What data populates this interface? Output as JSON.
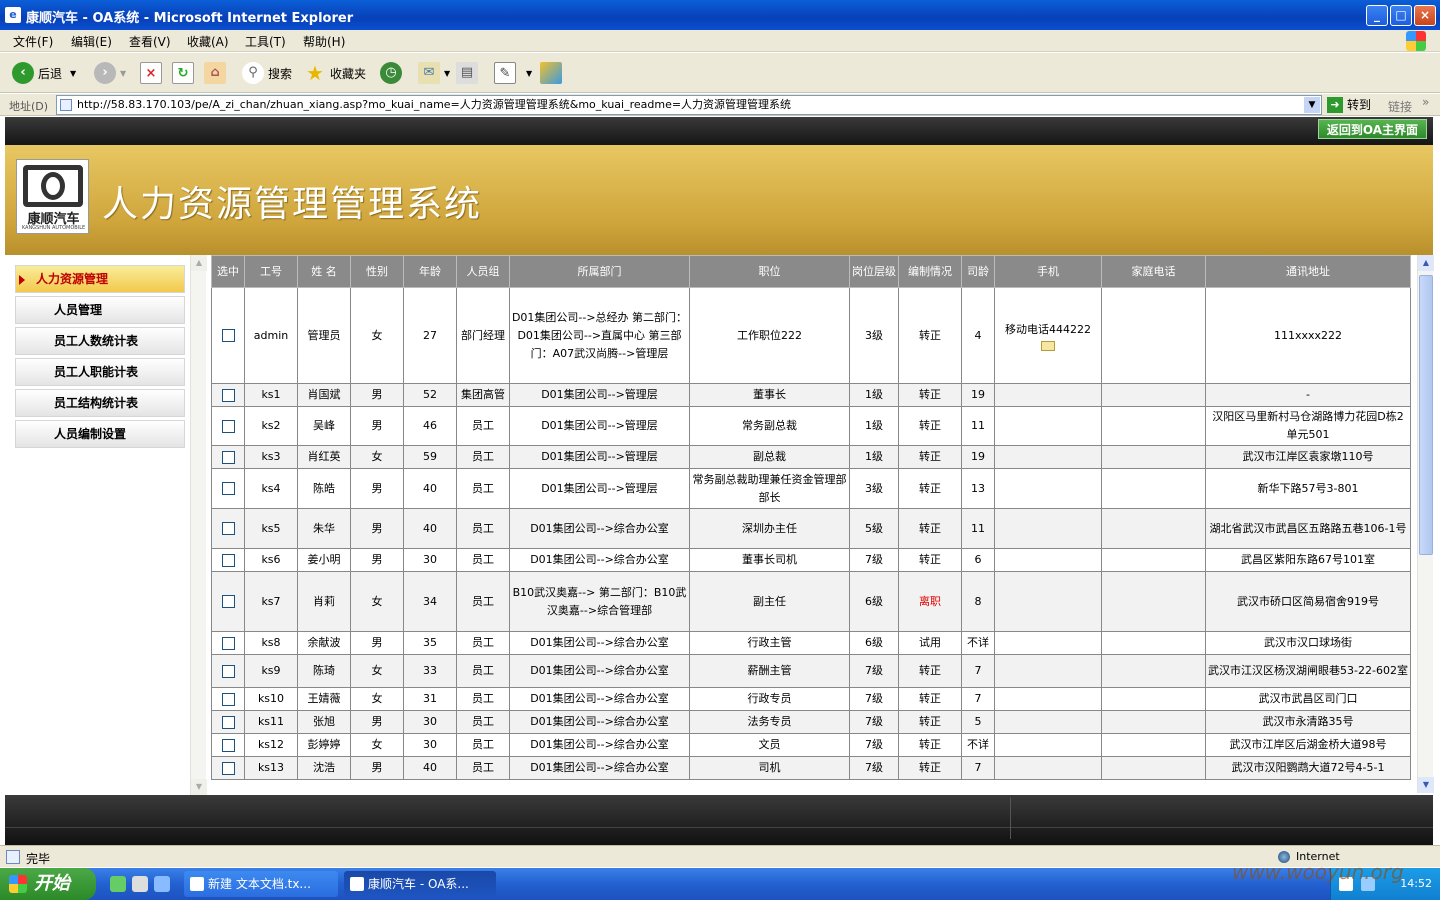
{
  "window": {
    "title": "康顺汽车 - OA系统 - Microsoft Internet Explorer",
    "min_glyph": "_",
    "max_glyph": "□",
    "close_glyph": "×"
  },
  "menu": [
    "文件(F)",
    "编辑(E)",
    "查看(V)",
    "收藏(A)",
    "工具(T)",
    "帮助(H)"
  ],
  "toolbar": {
    "back": "后退",
    "search": "搜索",
    "favorites": "收藏夹"
  },
  "address": {
    "label": "地址(D)",
    "url": "http://58.83.170.103/pe/A_zi_chan/zhuan_xiang.asp?mo_kuai_name=人力资源管理管理系统&mo_kuai_readme=人力资源管理管理系统",
    "go": "转到",
    "links": "链接"
  },
  "header": {
    "return_button": "返回到OA主界面",
    "logo_name": "康顺汽车",
    "logo_sub": "KANGSHUN AUTOMOBILE",
    "system_title": "人力资源管理管理系统"
  },
  "sidebar": {
    "items": [
      {
        "label": "人力资源管理",
        "active": true
      },
      {
        "label": "人员管理",
        "active": false
      },
      {
        "label": "员工人数统计表",
        "active": false
      },
      {
        "label": "员工人职能计表",
        "active": false
      },
      {
        "label": "员工结构统计表",
        "active": false
      },
      {
        "label": "人员编制设置",
        "active": false
      }
    ]
  },
  "table": {
    "columns": [
      "选中",
      "工号",
      "姓 名",
      "性别",
      "年龄",
      "人员组",
      "所属部门",
      "职位",
      "岗位层级",
      "编制情况",
      "司龄",
      "手机",
      "家庭电话",
      "通讯地址"
    ],
    "rows": [
      {
        "id": "admin",
        "name": "管理员",
        "gender": "女",
        "age": "27",
        "group": "部门经理",
        "dept": "D01集团公司-->总经办 第二部门：D01集团公司-->直属中心 第三部门：A07武汉尚腾-->管理层",
        "position": "工作职位222",
        "level": "3级",
        "status": "转正",
        "tenure": "4",
        "mobile": "移动电话444222",
        "home": "",
        "address": "111xxxx222"
      },
      {
        "id": "ks1",
        "name": "肖国斌",
        "gender": "男",
        "age": "52",
        "group": "集团高管",
        "dept": "D01集团公司-->管理层",
        "position": "董事长",
        "level": "1级",
        "status": "转正",
        "tenure": "19",
        "mobile": "",
        "home": "",
        "address": "-"
      },
      {
        "id": "ks2",
        "name": "吴峰",
        "gender": "男",
        "age": "46",
        "group": "员工",
        "dept": "D01集团公司-->管理层",
        "position": "常务副总裁",
        "level": "1级",
        "status": "转正",
        "tenure": "11",
        "mobile": "",
        "home": "",
        "address": "汉阳区马里新村马仓湖路博力花园D栋2单元501"
      },
      {
        "id": "ks3",
        "name": "肖红英",
        "gender": "女",
        "age": "59",
        "group": "员工",
        "dept": "D01集团公司-->管理层",
        "position": "副总裁",
        "level": "1级",
        "status": "转正",
        "tenure": "19",
        "mobile": "",
        "home": "",
        "address": "武汉市江岸区袁家墩110号"
      },
      {
        "id": "ks4",
        "name": "陈皓",
        "gender": "男",
        "age": "40",
        "group": "员工",
        "dept": "D01集团公司-->管理层",
        "position": "常务副总裁助理兼任资金管理部部长",
        "level": "3级",
        "status": "转正",
        "tenure": "13",
        "mobile": "",
        "home": "",
        "address": "新华下路57号3-801"
      },
      {
        "id": "ks5",
        "name": "朱华",
        "gender": "男",
        "age": "40",
        "group": "员工",
        "dept": "D01集团公司-->综合办公室",
        "position": "深圳办主任",
        "level": "5级",
        "status": "转正",
        "tenure": "11",
        "mobile": "",
        "home": "",
        "address": "湖北省武汉市武昌区五路路五巷106-1号"
      },
      {
        "id": "ks6",
        "name": "姜小明",
        "gender": "男",
        "age": "30",
        "group": "员工",
        "dept": "D01集团公司-->综合办公室",
        "position": "董事长司机",
        "level": "7级",
        "status": "转正",
        "tenure": "6",
        "mobile": "",
        "home": "",
        "address": "武昌区紫阳东路67号101室"
      },
      {
        "id": "ks7",
        "name": "肖莉",
        "gender": "女",
        "age": "34",
        "group": "员工",
        "dept": "B10武汉奥嘉--> 第二部门：B10武汉奥嘉-->综合管理部",
        "position": "副主任",
        "level": "6级",
        "status": "离职",
        "tenure": "8",
        "mobile": "",
        "home": "",
        "address": "武汉市硚口区简易宿舍919号"
      },
      {
        "id": "ks8",
        "name": "余献波",
        "gender": "男",
        "age": "35",
        "group": "员工",
        "dept": "D01集团公司-->综合办公室",
        "position": "行政主管",
        "level": "6级",
        "status": "试用",
        "tenure": "不详",
        "mobile": "",
        "home": "",
        "address": "武汉市汉口球场街"
      },
      {
        "id": "ks9",
        "name": "陈琦",
        "gender": "女",
        "age": "33",
        "group": "员工",
        "dept": "D01集团公司-->综合办公室",
        "position": "薪酬主管",
        "level": "7级",
        "status": "转正",
        "tenure": "7",
        "mobile": "",
        "home": "",
        "address": "武汉市江汉区杨汊湖闸眼巷53-22-602室"
      },
      {
        "id": "ks10",
        "name": "王婧薇",
        "gender": "女",
        "age": "31",
        "group": "员工",
        "dept": "D01集团公司-->综合办公室",
        "position": "行政专员",
        "level": "7级",
        "status": "转正",
        "tenure": "7",
        "mobile": "",
        "home": "",
        "address": "武汉市武昌区司门口"
      },
      {
        "id": "ks11",
        "name": "张旭",
        "gender": "男",
        "age": "30",
        "group": "员工",
        "dept": "D01集团公司-->综合办公室",
        "position": "法务专员",
        "level": "7级",
        "status": "转正",
        "tenure": "5",
        "mobile": "",
        "home": "",
        "address": "武汉市永清路35号"
      },
      {
        "id": "ks12",
        "name": "彭婷婷",
        "gender": "女",
        "age": "30",
        "group": "员工",
        "dept": "D01集团公司-->综合办公室",
        "position": "文员",
        "level": "7级",
        "status": "转正",
        "tenure": "不详",
        "mobile": "",
        "home": "",
        "address": "武汉市江岸区后湖金桥大道98号"
      },
      {
        "id": "ks13",
        "name": "沈浩",
        "gender": "男",
        "age": "40",
        "group": "员工",
        "dept": "D01集团公司-->综合办公室",
        "position": "司机",
        "level": "7级",
        "status": "转正",
        "tenure": "7",
        "mobile": "",
        "home": "",
        "address": "武汉市汉阳鹦鹉大道72号4-5-1"
      }
    ]
  },
  "status": {
    "text": "完毕",
    "zone": "Internet"
  },
  "taskbar": {
    "start": "开始",
    "tasks": [
      "新建 文本文档.tx...",
      "康顺汽车 - OA系..."
    ],
    "clock": "14:52"
  },
  "watermark": "www.wooyun.org",
  "colors": {
    "banner": "#d4aa44",
    "header_row": "#8a8a8a",
    "resigned_text": "#e00000",
    "return_button": "#3e9c38"
  }
}
